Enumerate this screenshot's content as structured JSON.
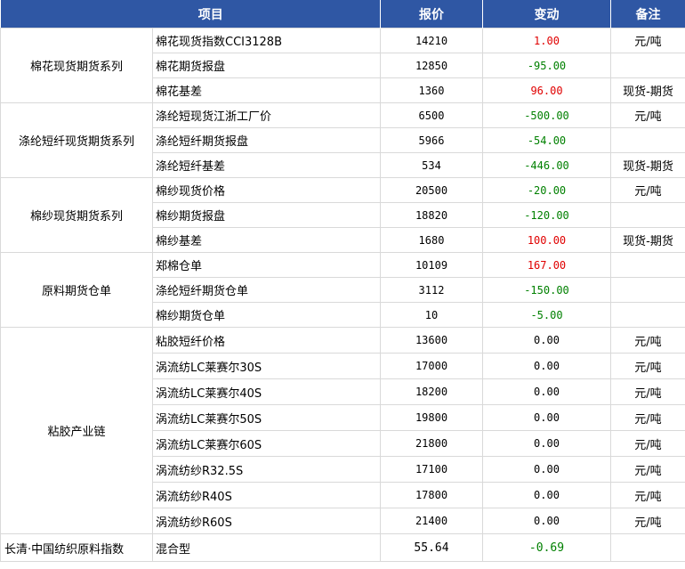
{
  "header": {
    "item": "项目",
    "price": "报价",
    "change": "变动",
    "note": "备注"
  },
  "groups": [
    {
      "name": "棉花现货期货系列",
      "rows": [
        {
          "item": "棉花现货指数CCI3128B",
          "price": "14210",
          "change": "1.00",
          "dir": "up",
          "note": "元/吨"
        },
        {
          "item": "棉花期货报盘",
          "price": "12850",
          "change": "-95.00",
          "dir": "down",
          "note": ""
        },
        {
          "item": "棉花基差",
          "price": "1360",
          "change": "96.00",
          "dir": "up",
          "note": "现货-期货"
        }
      ]
    },
    {
      "name": "涤纶短纤现货期货系列",
      "rows": [
        {
          "item": "涤纶短现货江浙工厂价",
          "price": "6500",
          "change": "-500.00",
          "dir": "down",
          "note": "元/吨"
        },
        {
          "item": "涤纶短纤期货报盘",
          "price": "5966",
          "change": "-54.00",
          "dir": "down",
          "note": ""
        },
        {
          "item": "涤纶短纤基差",
          "price": "534",
          "change": "-446.00",
          "dir": "down",
          "note": "现货-期货"
        }
      ]
    },
    {
      "name": "棉纱现货期货系列",
      "rows": [
        {
          "item": "棉纱现货价格",
          "price": "20500",
          "change": "-20.00",
          "dir": "down",
          "note": "元/吨"
        },
        {
          "item": "棉纱期货报盘",
          "price": "18820",
          "change": "-120.00",
          "dir": "down",
          "note": ""
        },
        {
          "item": "棉纱基差",
          "price": "1680",
          "change": "100.00",
          "dir": "up",
          "note": "现货-期货"
        }
      ]
    },
    {
      "name": "原料期货仓单",
      "rows": [
        {
          "item": "郑棉仓单",
          "price": "10109",
          "change": "167.00",
          "dir": "up",
          "note": ""
        },
        {
          "item": "涤纶短纤期货仓单",
          "price": "3112",
          "change": "-150.00",
          "dir": "down",
          "note": ""
        },
        {
          "item": "棉纱期货仓单",
          "price": "10",
          "change": "-5.00",
          "dir": "down",
          "note": ""
        }
      ]
    },
    {
      "name": "粘胶产业链",
      "rows": [
        {
          "item": "粘胶短纤价格",
          "price": "13600",
          "change": "0.00",
          "dir": "flat",
          "note": "元/吨"
        },
        {
          "item": "涡流纺LC莱赛尔30S",
          "price": "17000",
          "change": "0.00",
          "dir": "flat",
          "note": "元/吨"
        },
        {
          "item": "涡流纺LC莱赛尔40S",
          "price": "18200",
          "change": "0.00",
          "dir": "flat",
          "note": "元/吨"
        },
        {
          "item": "涡流纺LC莱赛尔50S",
          "price": "19800",
          "change": "0.00",
          "dir": "flat",
          "note": "元/吨"
        },
        {
          "item": "涡流纺LC莱赛尔60S",
          "price": "21800",
          "change": "0.00",
          "dir": "flat",
          "note": "元/吨"
        },
        {
          "item": "涡流纺纱R32.5S",
          "price": "17100",
          "change": "0.00",
          "dir": "flat",
          "note": "元/吨"
        },
        {
          "item": "涡流纺纱R40S",
          "price": "17800",
          "change": "0.00",
          "dir": "flat",
          "note": "元/吨"
        },
        {
          "item": "涡流纺纱R60S",
          "price": "21400",
          "change": "0.00",
          "dir": "flat",
          "note": "元/吨"
        }
      ]
    },
    {
      "name": "长清·中国纺织原料指数",
      "rows": [
        {
          "item": "混合型",
          "price": "55.64",
          "change": "-0.69",
          "dir": "down",
          "note": ""
        }
      ]
    }
  ],
  "colors": {
    "header_bg": "#2f57a4",
    "up": "#e00000",
    "down": "#008000",
    "grid": "#d9d9d9"
  }
}
